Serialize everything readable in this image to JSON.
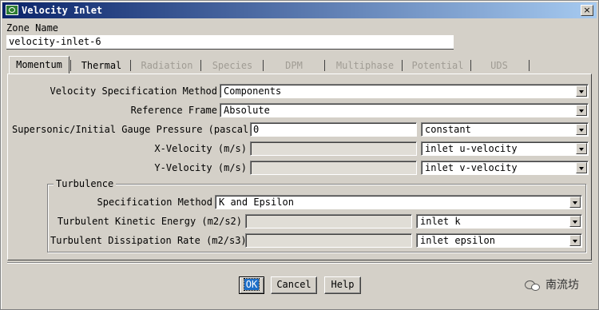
{
  "window": {
    "title": "Velocity Inlet",
    "close_glyph": "×",
    "icon": "app-icon"
  },
  "zone": {
    "label": "Zone Name",
    "value": "velocity-inlet-6"
  },
  "tabs": [
    {
      "label": "Momentum",
      "state": "active"
    },
    {
      "label": "Thermal",
      "state": "enabled"
    },
    {
      "label": "Radiation",
      "state": "disabled"
    },
    {
      "label": "Species",
      "state": "disabled"
    },
    {
      "label": "DPM",
      "state": "disabled"
    },
    {
      "label": "Multiphase",
      "state": "disabled"
    },
    {
      "label": "Potential",
      "state": "disabled"
    },
    {
      "label": "UDS",
      "state": "disabled"
    }
  ],
  "momentum": {
    "spec_method": {
      "label": "Velocity Specification Method",
      "value": "Components"
    },
    "ref_frame": {
      "label": "Reference Frame",
      "value": "Absolute"
    },
    "pressure": {
      "label": "Supersonic/Initial Gauge Pressure (pascal)",
      "value": "0",
      "profile": "constant"
    },
    "x_velocity": {
      "label": "X-Velocity (m/s)",
      "value": "",
      "profile": "inlet u-velocity"
    },
    "y_velocity": {
      "label": "Y-Velocity (m/s)",
      "value": "",
      "profile": "inlet v-velocity"
    }
  },
  "turbulence": {
    "title": "Turbulence",
    "spec_method": {
      "label": "Specification Method",
      "value": "K and Epsilon"
    },
    "tke": {
      "label": "Turbulent Kinetic Energy (m2/s2)",
      "value": "",
      "profile": "inlet k"
    },
    "tdr": {
      "label": "Turbulent Dissipation Rate (m2/s3)",
      "value": "",
      "profile": "inlet epsilon"
    }
  },
  "buttons": {
    "ok": "OK",
    "cancel": "Cancel",
    "help": "Help"
  },
  "watermark": {
    "text": "南流坊"
  },
  "colors": {
    "title_start": "#0a246a",
    "title_end": "#a6caf0",
    "ok_highlight": "#1e6fc8",
    "face": "#d4d0c8"
  }
}
